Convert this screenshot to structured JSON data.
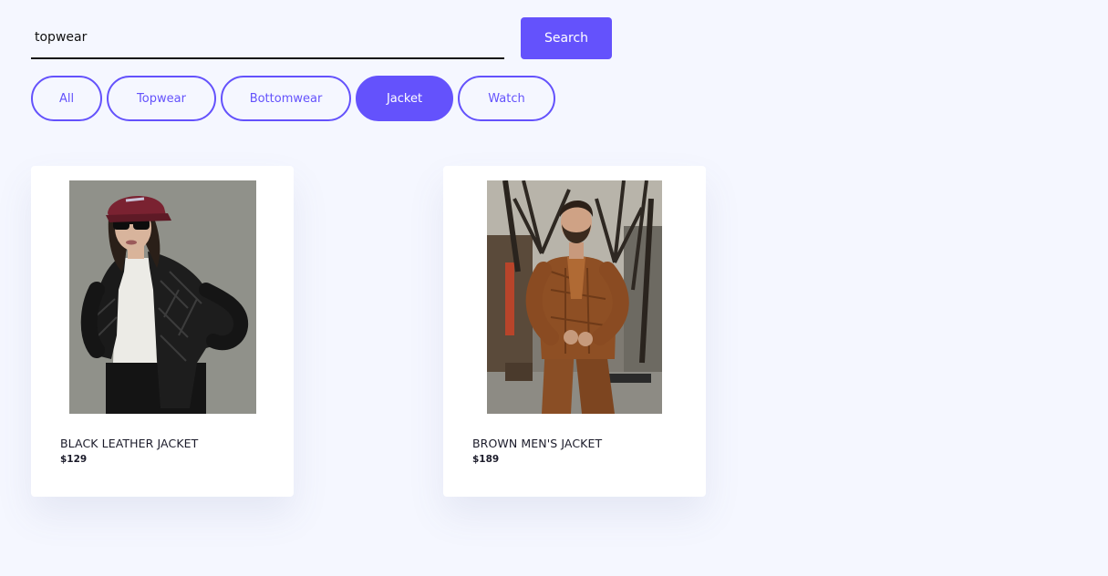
{
  "search": {
    "value": "topwear",
    "button_label": "Search"
  },
  "filters": [
    {
      "label": "All",
      "active": false
    },
    {
      "label": "Topwear",
      "active": false
    },
    {
      "label": "Bottomwear",
      "active": false
    },
    {
      "label": "Jacket",
      "active": true
    },
    {
      "label": "Watch",
      "active": false
    }
  ],
  "products": [
    {
      "title": "BLACK LEATHER JACKET",
      "price": "$129",
      "image": "photo of woman in black leather jacket and red cap"
    },
    {
      "title": "BROWN MEN'S JACKET",
      "price": "$189",
      "image": "photo of bearded man in brown plaid suit jacket"
    }
  ],
  "colors": {
    "accent": "#6452fc",
    "background": "#f5f7ff",
    "card": "#ffffff",
    "text": "#1b1b2a"
  }
}
